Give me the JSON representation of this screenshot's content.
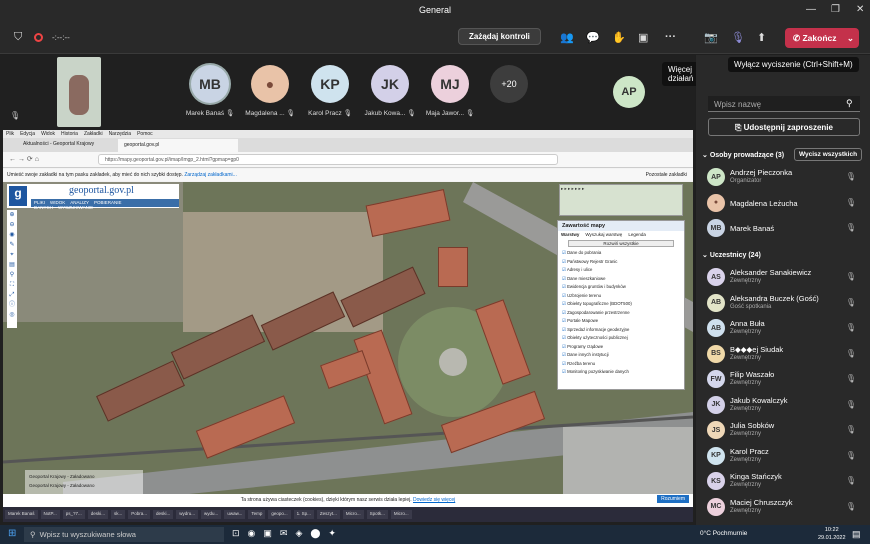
{
  "window": {
    "title": "General"
  },
  "toolbar": {
    "timer": "-:--:--",
    "request_control": "Zażądaj kontroli",
    "end_call": "Zakończ",
    "more_actions_tooltip": "Więcej działań",
    "mute_tooltip": "Wyłącz wyciszenie (Ctrl+Shift+M)"
  },
  "participants_strip": [
    {
      "initials": "MB",
      "name": "Marek Banaś",
      "color": "#c9d4e4"
    },
    {
      "initials": "",
      "name": "Magdalena ...",
      "color": "#e9c3a8"
    },
    {
      "initials": "KP",
      "name": "Karol Pracz",
      "color": "#cfe3ee"
    },
    {
      "initials": "JK",
      "name": "Jakub Kowa...",
      "color": "#d3d0e8"
    },
    {
      "initials": "MJ",
      "name": "Maja Jawor...",
      "color": "#ecd0dc"
    }
  ],
  "overflow_count": "+20",
  "ap_tile": {
    "initials": "AP"
  },
  "sidebar": {
    "search_placeholder": "Wpisz nazwę",
    "share_invite": "Udostępnij zaproszenie",
    "presenters_header": "Osoby prowadzące (3)",
    "mute_all": "Wycisz wszystkich",
    "attendees_header": "Uczestnicy (24)"
  },
  "presenters": [
    {
      "initials": "AP",
      "name": "Andrzej Pieczonka",
      "role": "Organizator",
      "color": "#cde6c7"
    },
    {
      "initials": "",
      "name": "Magdalena Leżucha",
      "role": "",
      "color": "#e9c3a8"
    },
    {
      "initials": "MB",
      "name": "Marek Banaś",
      "role": "",
      "color": "#c9d4e4"
    }
  ],
  "attendees": [
    {
      "initials": "AS",
      "name": "Aleksander Sanakiewicz",
      "role": "Zewnętrzny",
      "color": "#d9d2ea"
    },
    {
      "initials": "AB",
      "name": "Aleksandra Buczek (Gość)",
      "role": "Gość spotkania",
      "color": "#e2e4c8"
    },
    {
      "initials": "AB",
      "name": "Anna Buła",
      "role": "Zewnętrzny",
      "color": "#cfe0ee"
    },
    {
      "initials": "BS",
      "name": "B◆◆◆ej Siudak",
      "role": "Zewnętrzny",
      "color": "#f0d9a8"
    },
    {
      "initials": "FW",
      "name": "Filip Waszało",
      "role": "Zewnętrzny",
      "color": "#d4d7ec"
    },
    {
      "initials": "JK",
      "name": "Jakub Kowalczyk",
      "role": "Zewnętrzny",
      "color": "#d3d0e8"
    },
    {
      "initials": "JS",
      "name": "Julia Sobków",
      "role": "Zewnętrzny",
      "color": "#efd8b8"
    },
    {
      "initials": "KP",
      "name": "Karol Pracz",
      "role": "Zewnętrzny",
      "color": "#cfe3ee"
    },
    {
      "initials": "KS",
      "name": "Kinga Stańczyk",
      "role": "Zewnętrzny",
      "color": "#d9d2ea"
    },
    {
      "initials": "MC",
      "name": "Maciej Chruszczyk",
      "role": "Zewnętrzny",
      "color": "#ecd0dc"
    }
  ],
  "browser": {
    "menu": [
      "Plik",
      "Edycja",
      "Widok",
      "Historia",
      "Zakładki",
      "Narzędzia",
      "Pomoc"
    ],
    "tabs": [
      "Aktualności - Geoportal Krajowy",
      "geoportal.gov.pl"
    ],
    "url": "https://mapy.geoportal.gov.pl/imap/Imgp_2.html?gpmap=gp0",
    "bookmark_msg": "Umieść swoje zakładki na tym pasku zakładek, aby mieć do nich szybki dostęp.",
    "bookmark_link": "Zarządzaj zakładkami...",
    "other_bookmarks": "Pozostałe zakładki"
  },
  "geoportal": {
    "logo": "geoportal.gov.pl",
    "menu": [
      "PLIKI",
      "WIDOK",
      "ANALIZY",
      "POBIERANIE DANYCH",
      "WYSZUKIWANIE"
    ],
    "contents_title": "Zawartość mapy",
    "contents_tabs": [
      "Warstwy",
      "Wyszukaj warstwę",
      "Legenda"
    ],
    "contents_btn": "Rozwiń wszystkie",
    "layers": [
      "Dane do pobrania",
      "Państwowy Rejestr Granic",
      "Adresy i ulice",
      "Dane mieszkaniowe",
      "Ewidencja gruntów i budynków",
      "Uzbrojenie terenu",
      "Obiekty topograficzne (BDOT500)",
      "Zagospodarowanie przestrzenne",
      "Portale Mapowe",
      "Sprzedaż informacje geodezyjne",
      "Obiekty użyteczności publicznej",
      "Programy rządowe",
      "Dane innych instytucji",
      "Rzeźba terenu",
      "Monitoring pozyskiwanie danych"
    ],
    "cookie": "Ta strona używa ciasteczek (cookies), dzięki którym nasz serwis działa lepiej.",
    "cookie_link": "Dowiedz się więcej",
    "cookie_btn": "Rozumiem",
    "status": [
      "Geoportal Krajowy - Załadowano",
      "Geoportal Krajowy - Załadowano"
    ]
  },
  "taskbar": {
    "search": "Wpisz tu wyszukiwane słowa",
    "weather": "0°C Pochmurnie",
    "time": "10:22",
    "date": "29.01.2022",
    "items": [
      "Marek Banaś",
      "NotP...",
      "ps_?7...",
      "deski...",
      "sk...",
      "Pobra...",
      "deski...",
      "wydru...",
      "wydu...",
      "uwaw...",
      "Temp",
      "geopo...",
      "1. Sp...",
      "Zeszyt...",
      "Micro...",
      "Spotk...",
      "Micro..."
    ]
  }
}
